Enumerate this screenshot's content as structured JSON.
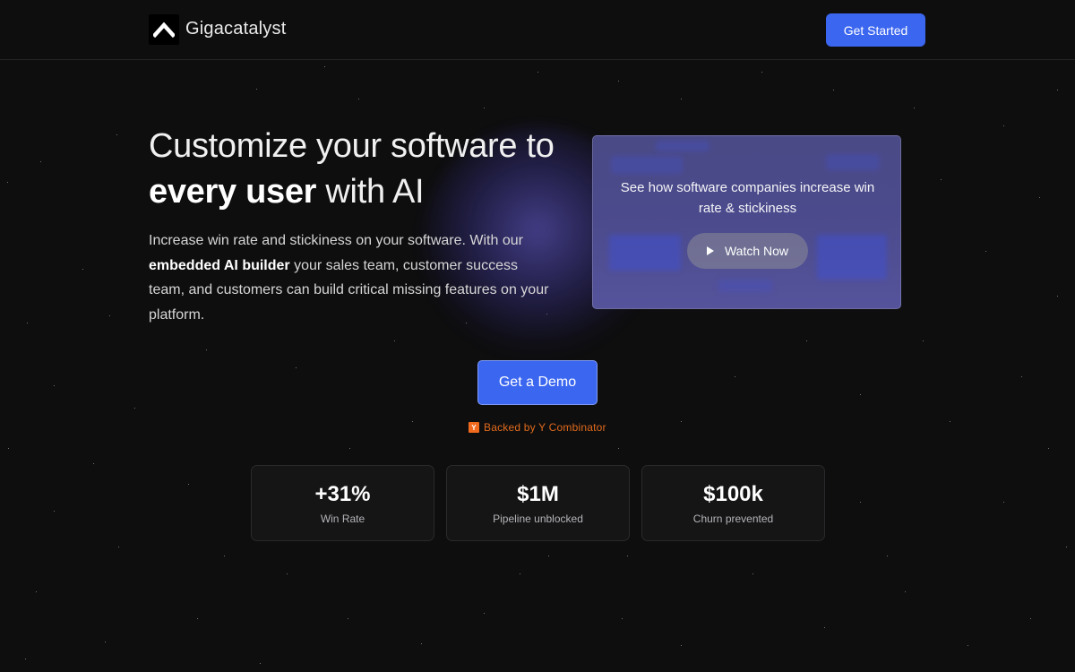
{
  "nav": {
    "brand": "Gigacatalyst",
    "cta_label": "Get Started"
  },
  "hero": {
    "headline_line1": "Customize your software to",
    "headline_bold": "every user",
    "headline_rest": " with AI",
    "sub_part1": "Increase win rate and stickiness on your software. With our ",
    "sub_bold": "embedded AI builder",
    "sub_part2": " your sales team, customer success team, and customers can build critical missing features on your platform."
  },
  "video": {
    "caption": "See how software companies increase win rate & stickiness",
    "button_label": "Watch Now"
  },
  "cta": {
    "demo_label": "Get a Demo",
    "backed_badge": "Y",
    "backed_text": "Backed by Y Combinator"
  },
  "stats": [
    {
      "value": "+31%",
      "label": "Win Rate"
    },
    {
      "value": "$1M",
      "label": "Pipeline unblocked"
    },
    {
      "value": "$100k",
      "label": "Churn prevented"
    }
  ],
  "colors": {
    "accent": "#3b66f0",
    "yc_orange": "#f06a1d",
    "background": "#0e0e0f"
  },
  "icons": {
    "logo": "chevron-up-icon",
    "play": "play-icon"
  }
}
